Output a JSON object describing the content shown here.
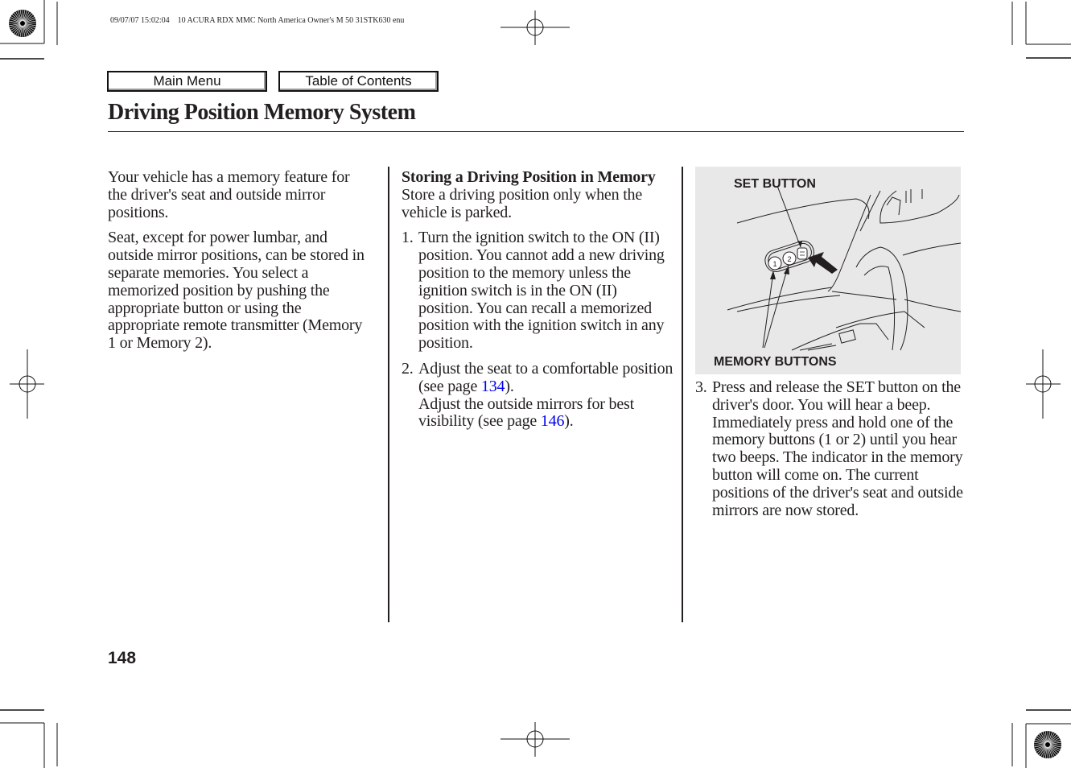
{
  "header": {
    "print_meta": "09/07/07 15:02:04    10 ACURA RDX MMC North America Owner's M 50 31STK630 enu"
  },
  "nav": {
    "main_menu_label": "Main Menu",
    "toc_label": "Table of Contents"
  },
  "page": {
    "title": "Driving Position Memory System",
    "number": "148"
  },
  "column1": {
    "paragraphs": [
      "Your vehicle has a memory feature for the driver's seat and outside mirror positions.",
      "Seat, except for power lumbar, and outside mirror positions, can be stored in separate memories. You select a memorized position by pushing the appropriate button or using the appropriate remote transmitter (Memory 1 or Memory 2)."
    ]
  },
  "column2": {
    "heading": "Storing a Driving Position in Memory",
    "intro": "Store a driving position only when the vehicle is parked.",
    "steps": [
      {
        "num": "1.",
        "text": "Turn the ignition switch to the ON (II) position. You cannot add a new driving position to the memory unless the ignition switch is in the ON (II) position. You can recall a memorized position with the ignition switch in any position."
      },
      {
        "num": "2.",
        "text_a": "Adjust the seat to a comfortable position (see page ",
        "link_a": "134",
        "text_b": ").",
        "text_c": "Adjust the outside mirrors for best visibility (see page ",
        "link_c": "146",
        "text_d": ")."
      }
    ]
  },
  "figure": {
    "set_button_label": "SET BUTTON",
    "memory_buttons_label": "MEMORY BUTTONS",
    "button_1": "1",
    "button_2": "2"
  },
  "column3": {
    "steps": [
      {
        "num": "3.",
        "text": "Press and release the SET button on the driver's door. You will hear a beep. Immediately press and hold one of the memory buttons (1 or 2) until you hear two beeps. The indicator in the memory button will come on. The current positions of the driver's seat and outside mirrors are now stored."
      }
    ]
  },
  "colors": {
    "text": "#231f20",
    "link": "#0000ee",
    "figure_bg": "#e8e8e8"
  }
}
